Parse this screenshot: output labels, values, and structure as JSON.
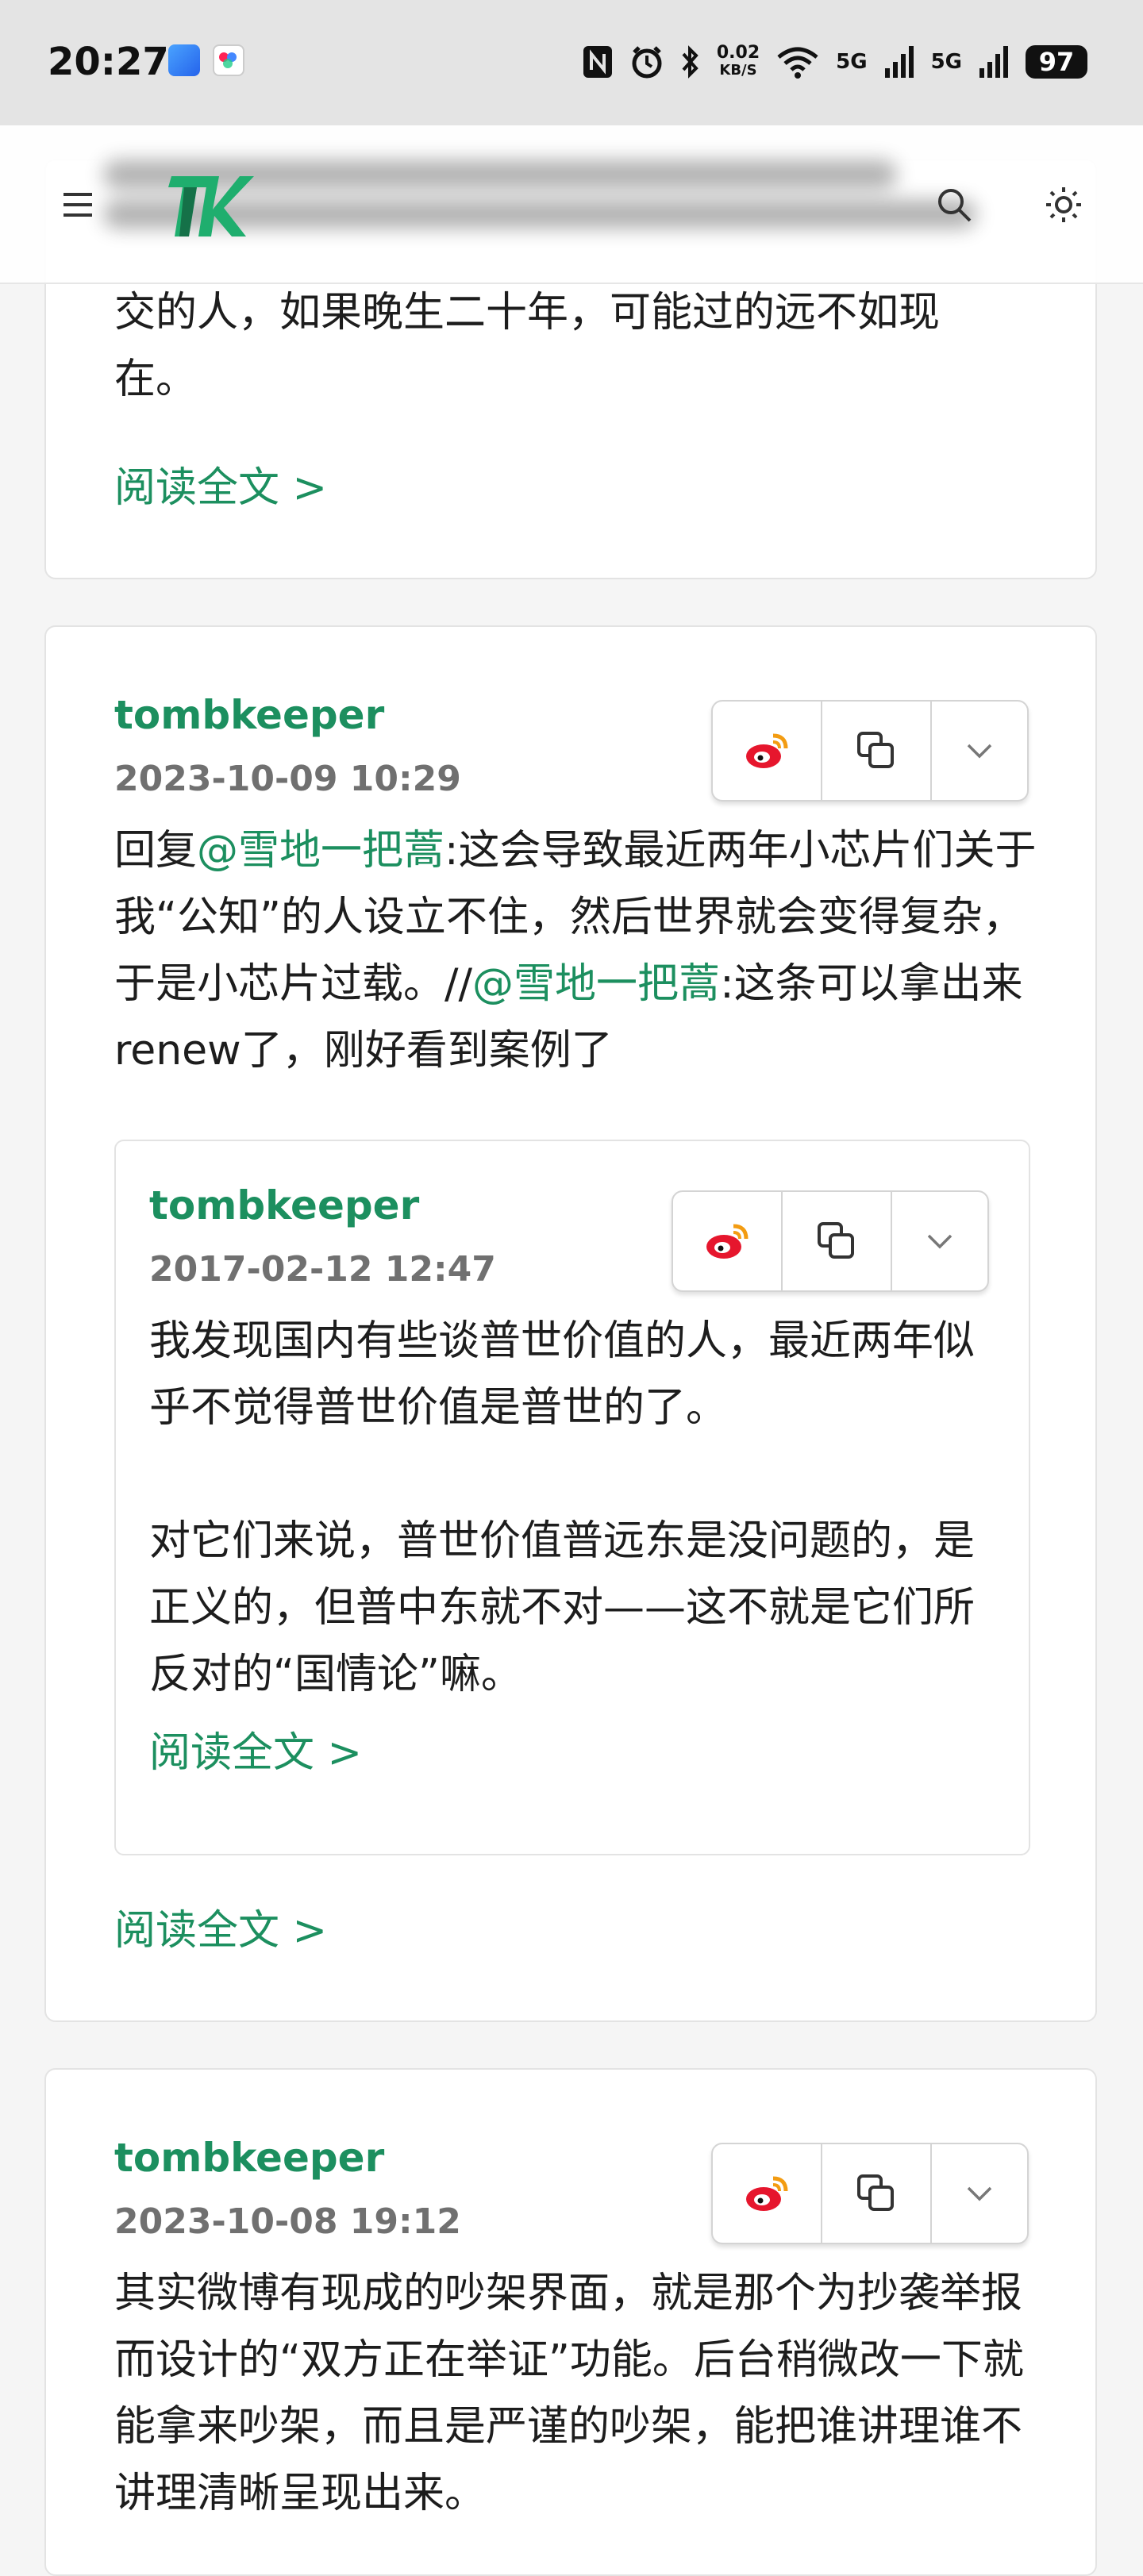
{
  "status_bar": {
    "time": "20:27",
    "speed_value": "0.02",
    "speed_unit": "KB/S",
    "net1": "5G",
    "net2": "5G",
    "battery": "97"
  },
  "theme": {
    "accent": "#1c8f5f",
    "muted": "#707070"
  },
  "cards": [
    {
      "partial_text": "交的人，如果晚生二十年，可能过的远不如现\n在。",
      "read_more": "阅读全文 >"
    },
    {
      "author": "tombkeeper",
      "date": "2023-10-09 10:29",
      "text": {
        "prefix": "回复",
        "mention1": "@雪地一把蒿",
        "part1": ":这会导致最近两年小芯片们关于我“公知”的人设立不住，然后世界就会变得复杂，于是小芯片过载。//",
        "mention2": "@雪地一把蒿",
        "part2": ":这条可以拿出来renew了，刚好看到案例了"
      },
      "quoted": {
        "author": "tombkeeper",
        "date": "2017-02-12 12:47",
        "text": "我发现国内有些谈普世价值的人，最近两年似乎不觉得普世价值是普世的了。\n\n对它们来说，普世价值普远东是没问题的，是正义的，但普中东就不对——这不就是它们所反对的“国情论”嘛。",
        "read_more": "阅读全文 >"
      },
      "read_more": "阅读全文 >"
    },
    {
      "author": "tombkeeper",
      "date": "2023-10-08 19:12",
      "text": "其实微博有现成的吵架界面，就是那个为抄袭举报而设计的“双方正在举证”功能。后台稍微改一下就能拿来吵架，而且是严谨的吵架，能把谁讲理谁不讲理清晰呈现出来。"
    }
  ],
  "icons": [
    "menu-icon",
    "search-icon",
    "theme-toggle-icon",
    "weibo-icon",
    "copy-icon",
    "chevron-down-icon"
  ]
}
